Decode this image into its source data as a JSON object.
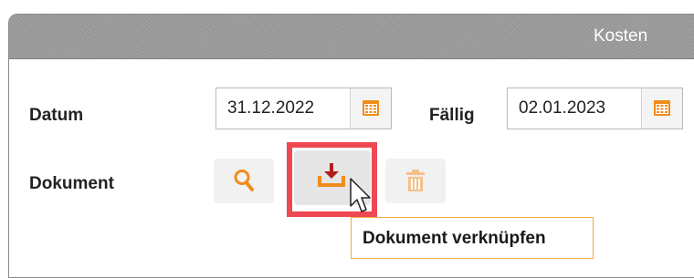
{
  "header": {
    "title": "Kosten"
  },
  "fields": {
    "datum": {
      "label": "Datum",
      "value": "31.12.2022"
    },
    "faellig": {
      "label": "Fällig",
      "value": "02.01.2023"
    },
    "dokument": {
      "label": "Dokument"
    }
  },
  "actions": {
    "search_icon": "search-icon",
    "link_icon": "download-tray-icon",
    "delete_icon": "trash-icon"
  },
  "tooltip": {
    "text": "Dokument verknüpfen"
  },
  "colors": {
    "accent_orange": "#f08c1a",
    "link_arrow": "#b0211c",
    "highlight_red": "#ee4852",
    "header_gray": "#9b9b9b"
  }
}
